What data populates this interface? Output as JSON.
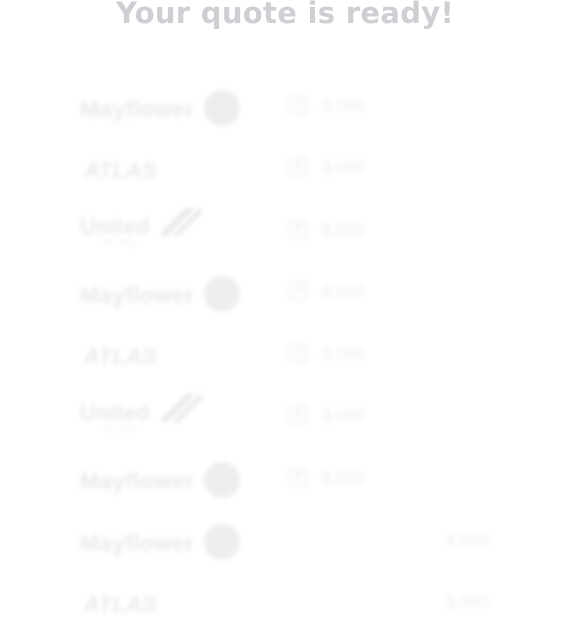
{
  "header": {
    "title": "Your quote is ready!"
  },
  "help_glyph": "?",
  "quotes": [
    {
      "carrier": "Mayflower",
      "logo_sub": "",
      "logo": "mayflower-logo",
      "price": "$,000"
    },
    {
      "carrier": "ATLAS",
      "logo_sub": "",
      "logo": "atlas-logo",
      "price": "$,000"
    },
    {
      "carrier": "United",
      "logo_sub": "Van Lines",
      "logo": "united-logo",
      "price": "$,000"
    },
    {
      "carrier": "Mayflower",
      "logo_sub": "",
      "logo": "mayflower-logo",
      "price": "$,000"
    },
    {
      "carrier": "ATLAS",
      "logo_sub": "",
      "logo": "atlas-logo",
      "price": "$,000"
    },
    {
      "carrier": "United",
      "logo_sub": "Van Lines",
      "logo": "united-logo",
      "price": "$,000"
    },
    {
      "carrier": "Mayflower",
      "logo_sub": "",
      "logo": "mayflower-logo",
      "price": "$,000"
    },
    {
      "carrier": "Mayflower",
      "logo_sub": "",
      "logo": "mayflower-logo",
      "price": "$,000"
    },
    {
      "carrier": "ATLAS",
      "logo_sub": "",
      "logo": "atlas-logo",
      "price": "$,000"
    }
  ],
  "colors": {
    "title": "#cdcfd3",
    "blurred_content": "#e9eaec",
    "background": "#ffffff"
  }
}
